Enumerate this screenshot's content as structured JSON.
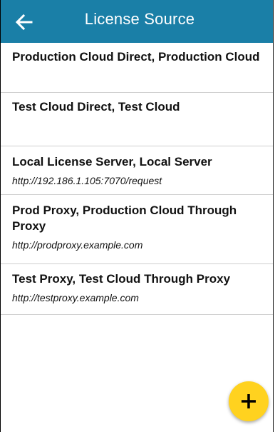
{
  "header": {
    "title": "License Source",
    "back_icon": "arrow-left-icon",
    "background_color": "#1a7fa7",
    "text_color": "#ffffff"
  },
  "sources": [
    {
      "name": "Production Cloud Direct, Production Cloud",
      "url": ""
    },
    {
      "name": "Test Cloud Direct, Test Cloud",
      "url": ""
    },
    {
      "name": "Local License Server, Local Server",
      "url": "http://192.186.1.105:7070/request"
    },
    {
      "name": "Prod Proxy, Production Cloud Through Proxy",
      "url": "http://prodproxy.example.com"
    },
    {
      "name": "Test Proxy, Test Cloud Through Proxy",
      "url": "http://testproxy.example.com"
    }
  ],
  "fab": {
    "icon": "plus-icon",
    "color": "#ffd21f"
  }
}
